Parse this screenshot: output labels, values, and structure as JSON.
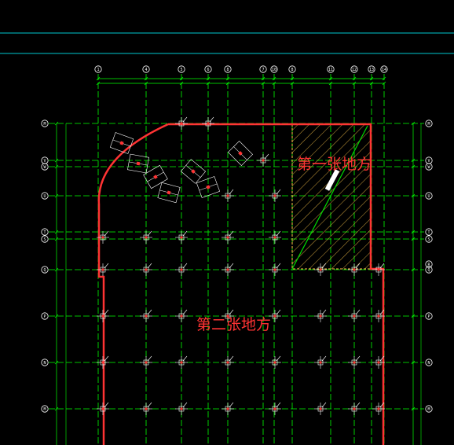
{
  "drawing": {
    "background": "#000000",
    "colors": {
      "axis_line": "#00ff00",
      "axis_bubble": "#ffffff",
      "boundary": "#ff3333",
      "hatch": "#ffc84a",
      "dimension": "#00ff00",
      "cyan_rule": "#00c8d0",
      "column": "#ff3333",
      "rebar": "#ffffff",
      "diagonal": "#00dd00"
    },
    "grid_top_labels": [
      "1",
      "4",
      "5",
      "6",
      "8",
      "7",
      "10",
      "8",
      "11",
      "12",
      "13",
      "14"
    ],
    "grid_side_labels": [
      "M",
      "V",
      "W",
      "U",
      "T",
      "S",
      "Q",
      "P",
      "N",
      "M"
    ],
    "grid_right_extra_labels": [
      "R"
    ]
  },
  "regions": [
    {
      "label": "第一张地方",
      "color": "#ff3333"
    },
    {
      "label": "第二张地方",
      "color": "#ff3333"
    }
  ]
}
